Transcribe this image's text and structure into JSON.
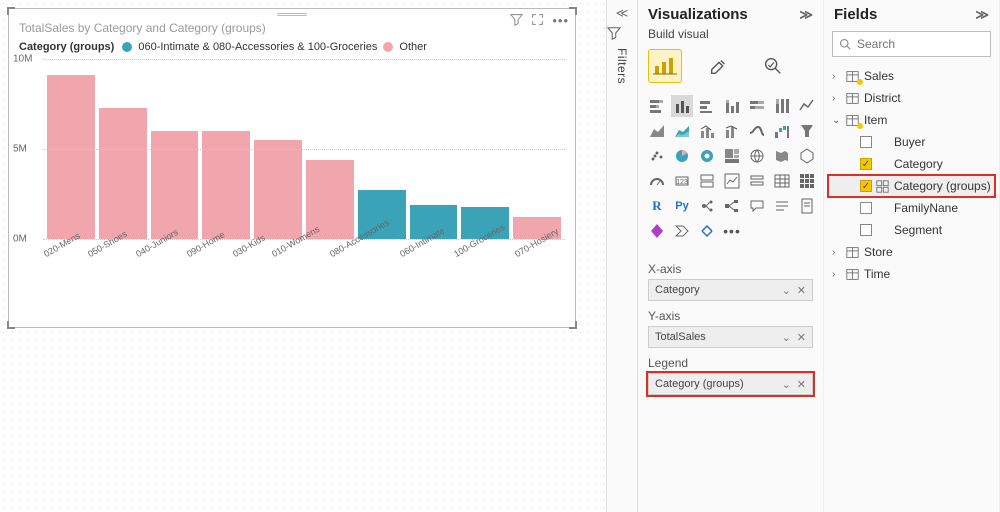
{
  "chart_data": {
    "type": "bar",
    "title": "TotalSales by Category and Category (groups)",
    "ylabel": "",
    "xlabel": "",
    "ylim": [
      0,
      10000000
    ],
    "yticks": [
      {
        "v": 0,
        "label": "0M"
      },
      {
        "v": 5000000,
        "label": "5M"
      },
      {
        "v": 10000000,
        "label": "10M"
      }
    ],
    "legend_title": "Category (groups)",
    "series_colors": {
      "Other": "#f1a5ac",
      "060-Intimate & 080-Accessories & 100-Groceries": "#3aa3b7"
    },
    "legend": [
      {
        "name": "060-Intimate & 080-Accessories & 100-Groceries",
        "color": "#3aa3b7"
      },
      {
        "name": "Other",
        "color": "#f1a5ac"
      }
    ],
    "categories": [
      "020-Mens",
      "050-Shoes",
      "040-Juniors",
      "090-Home",
      "030-Kids",
      "010-Womens",
      "080-Accessories",
      "060-Intimate",
      "100-Groceries",
      "070-Hosiery"
    ],
    "values": [
      9100000,
      7300000,
      6000000,
      6000000,
      5500000,
      4400000,
      2700000,
      1900000,
      1800000,
      1200000
    ],
    "groups": [
      "Other",
      "Other",
      "Other",
      "Other",
      "Other",
      "Other",
      "060-Intimate & 080-Accessories & 100-Groceries",
      "060-Intimate & 080-Accessories & 100-Groceries",
      "060-Intimate & 080-Accessories & 100-Groceries",
      "Other"
    ]
  },
  "filters": {
    "label": "Filters"
  },
  "viz": {
    "title": "Visualizations",
    "sub": "Build visual",
    "wells": {
      "xaxis": {
        "label": "X-axis",
        "value": "Category"
      },
      "yaxis": {
        "label": "Y-axis",
        "value": "TotalSales"
      },
      "legend": {
        "label": "Legend",
        "value": "Category (groups)"
      }
    }
  },
  "fields": {
    "title": "Fields",
    "search_placeholder": "Search",
    "tables": [
      {
        "name": "Sales",
        "expanded": false,
        "badge": true,
        "items": []
      },
      {
        "name": "District",
        "expanded": false,
        "items": []
      },
      {
        "name": "Item",
        "expanded": true,
        "badge": true,
        "items": [
          {
            "name": "Buyer",
            "checked": false
          },
          {
            "name": "Category",
            "checked": true
          },
          {
            "name": "Category (groups)",
            "checked": true,
            "highlight": true,
            "groupIcon": true
          },
          {
            "name": "FamilyNane",
            "checked": false
          },
          {
            "name": "Segment",
            "checked": false
          }
        ]
      },
      {
        "name": "Store",
        "expanded": false,
        "items": []
      },
      {
        "name": "Time",
        "expanded": false,
        "items": []
      }
    ]
  }
}
